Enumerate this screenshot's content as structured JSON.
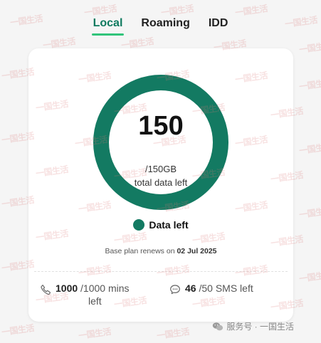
{
  "tabs": [
    {
      "label": "Local",
      "active": true
    },
    {
      "label": "Roaming",
      "active": false
    },
    {
      "label": "IDD",
      "active": false
    }
  ],
  "data_usage": {
    "remaining": "150",
    "total": "/150GB",
    "caption": "total data left",
    "fraction_left": 1.0,
    "legend_label": "Data left",
    "color": "#137a62"
  },
  "plan": {
    "renew_prefix": "Base plan renews on",
    "renew_date": "02 Jul 2025"
  },
  "allowances": {
    "mins": {
      "used": "1000",
      "total": "/1000 mins",
      "suffix": "left"
    },
    "sms": {
      "used": "46",
      "total": "/50 SMS left"
    }
  },
  "footer": {
    "brand": "服务号 · 一国生活"
  },
  "watermark": "一国生活",
  "icons": {
    "phone": "phone-icon",
    "sms": "message-icon",
    "wechat": "wechat-icon"
  },
  "colors": {
    "accent": "#0f7a5f",
    "tab_underline": "#31c47a",
    "ring": "#137a62"
  }
}
